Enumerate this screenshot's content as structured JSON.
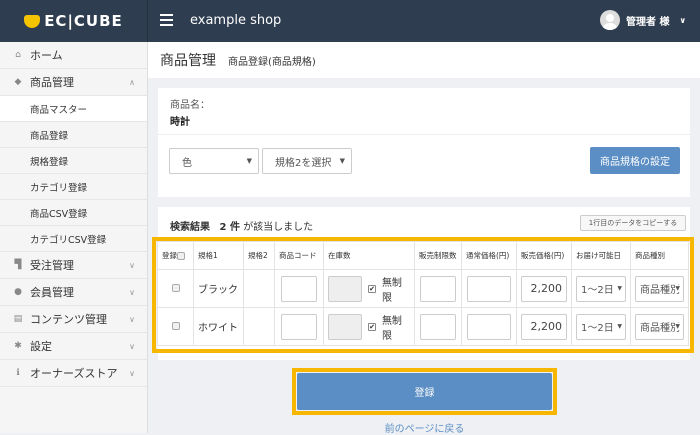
{
  "header": {
    "logo": "EC|CUBE",
    "shop_name": "example shop",
    "user": "管理者 様"
  },
  "sidebar": {
    "items": [
      {
        "label": "ホーム",
        "icon": "home-icon"
      },
      {
        "label": "商品管理",
        "icon": "tag-icon",
        "expanded": true,
        "children": [
          "商品マスター",
          "商品登録",
          "規格登録",
          "カテゴリ登録",
          "商品CSV登録",
          "カテゴリCSV登録"
        ]
      },
      {
        "label": "受注管理",
        "icon": "cart-icon"
      },
      {
        "label": "会員管理",
        "icon": "users-icon"
      },
      {
        "label": "コンテンツ管理",
        "icon": "file-icon"
      },
      {
        "label": "設定",
        "icon": "gear-icon"
      },
      {
        "label": "オーナーズストア",
        "icon": "info-icon"
      }
    ]
  },
  "page": {
    "title": "商品管理",
    "subtitle": "商品登録(商品規格)"
  },
  "product": {
    "name_label": "商品名：",
    "name": "時計"
  },
  "class_select": {
    "class1": "色",
    "class2": "規格2を選択",
    "setting_button": "商品規格の設定"
  },
  "results": {
    "label": "検索結果",
    "count": "2 件",
    "suffix": "が該当しました",
    "copy_button": "1行目のデータをコピーする"
  },
  "table": {
    "headers": [
      "登録",
      "規格1",
      "規格2",
      "商品コード",
      "在庫数",
      "販売制限数",
      "通常価格(円)",
      "販売価格(円)",
      "お届け可能日",
      "商品種別"
    ],
    "rows": [
      {
        "class1": "ブラック",
        "class2": "",
        "code": "",
        "stock": "",
        "unlimited_label": "無制限",
        "unlimited": true,
        "sale_limit": "",
        "normal_price": "",
        "price": "2,200",
        "delivery": "1〜2日",
        "type": "商品種別"
      },
      {
        "class1": "ホワイト",
        "class2": "",
        "code": "",
        "stock": "",
        "unlimited_label": "無制限",
        "unlimited": true,
        "sale_limit": "",
        "normal_price": "",
        "price": "2,200",
        "delivery": "1〜2日",
        "type": "商品種別"
      }
    ]
  },
  "actions": {
    "register": "登録",
    "back": "前のページに戻る"
  },
  "colors": {
    "header": "#2e3d4f",
    "primary": "#5b8ec4",
    "highlight": "#f7b600"
  }
}
